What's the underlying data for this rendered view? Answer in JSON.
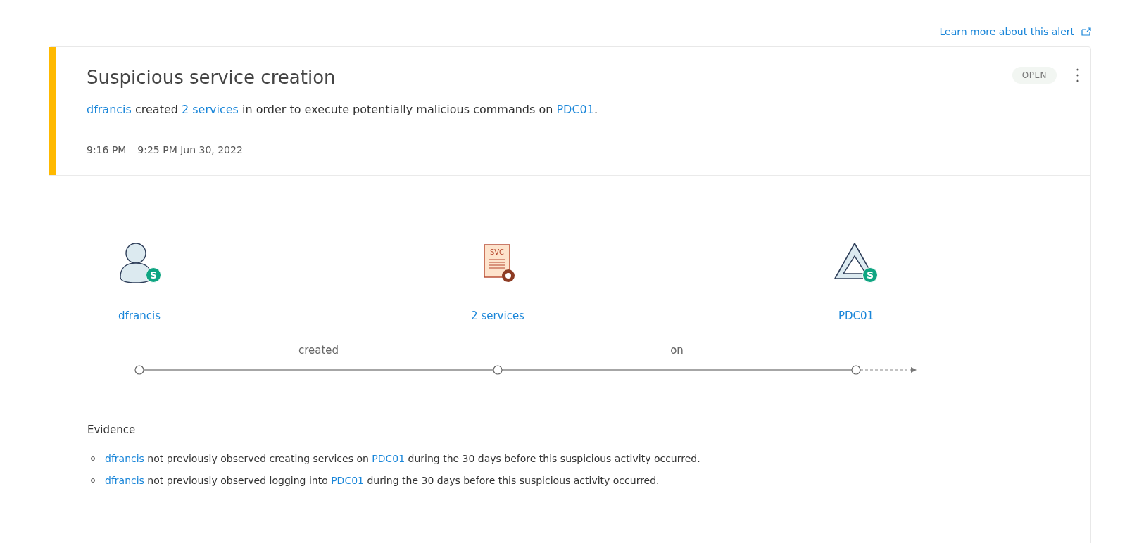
{
  "learn_more_link": {
    "label": "Learn more about this alert"
  },
  "alert": {
    "title": "Suspicious service creation",
    "status": "OPEN",
    "description": [
      {
        "kind": "link",
        "text": "dfrancis"
      },
      {
        "kind": "text",
        "text": " created "
      },
      {
        "kind": "link",
        "text": "2 services"
      },
      {
        "kind": "text",
        "text": " in order to execute potentially malicious commands on "
      },
      {
        "kind": "link",
        "text": "PDC01"
      },
      {
        "kind": "text",
        "text": "."
      }
    ],
    "time_range": "9:16 PM – 9:25 PM",
    "date": "Jun 30, 2022"
  },
  "graph": {
    "nodes": [
      {
        "kind": "user",
        "label": "dfrancis",
        "badge": "S"
      },
      {
        "kind": "service",
        "label": "2 services",
        "icon_text": "SVC"
      },
      {
        "kind": "computer",
        "label": "PDC01",
        "badge": "S"
      }
    ],
    "edges": [
      {
        "label": "created"
      },
      {
        "label": "on"
      }
    ],
    "continues": true
  },
  "evidence": {
    "heading": "Evidence",
    "items": [
      [
        {
          "kind": "link",
          "text": "dfrancis"
        },
        {
          "kind": "text",
          "text": " not previously observed creating services on "
        },
        {
          "kind": "link",
          "text": "PDC01"
        },
        {
          "kind": "text",
          "text": " during the 30 days before this suspicious activity occurred."
        }
      ],
      [
        {
          "kind": "link",
          "text": "dfrancis"
        },
        {
          "kind": "text",
          "text": " not previously observed logging into "
        },
        {
          "kind": "link",
          "text": "PDC01"
        },
        {
          "kind": "text",
          "text": " during the 30 days before this suspicious activity occurred."
        }
      ]
    ]
  }
}
